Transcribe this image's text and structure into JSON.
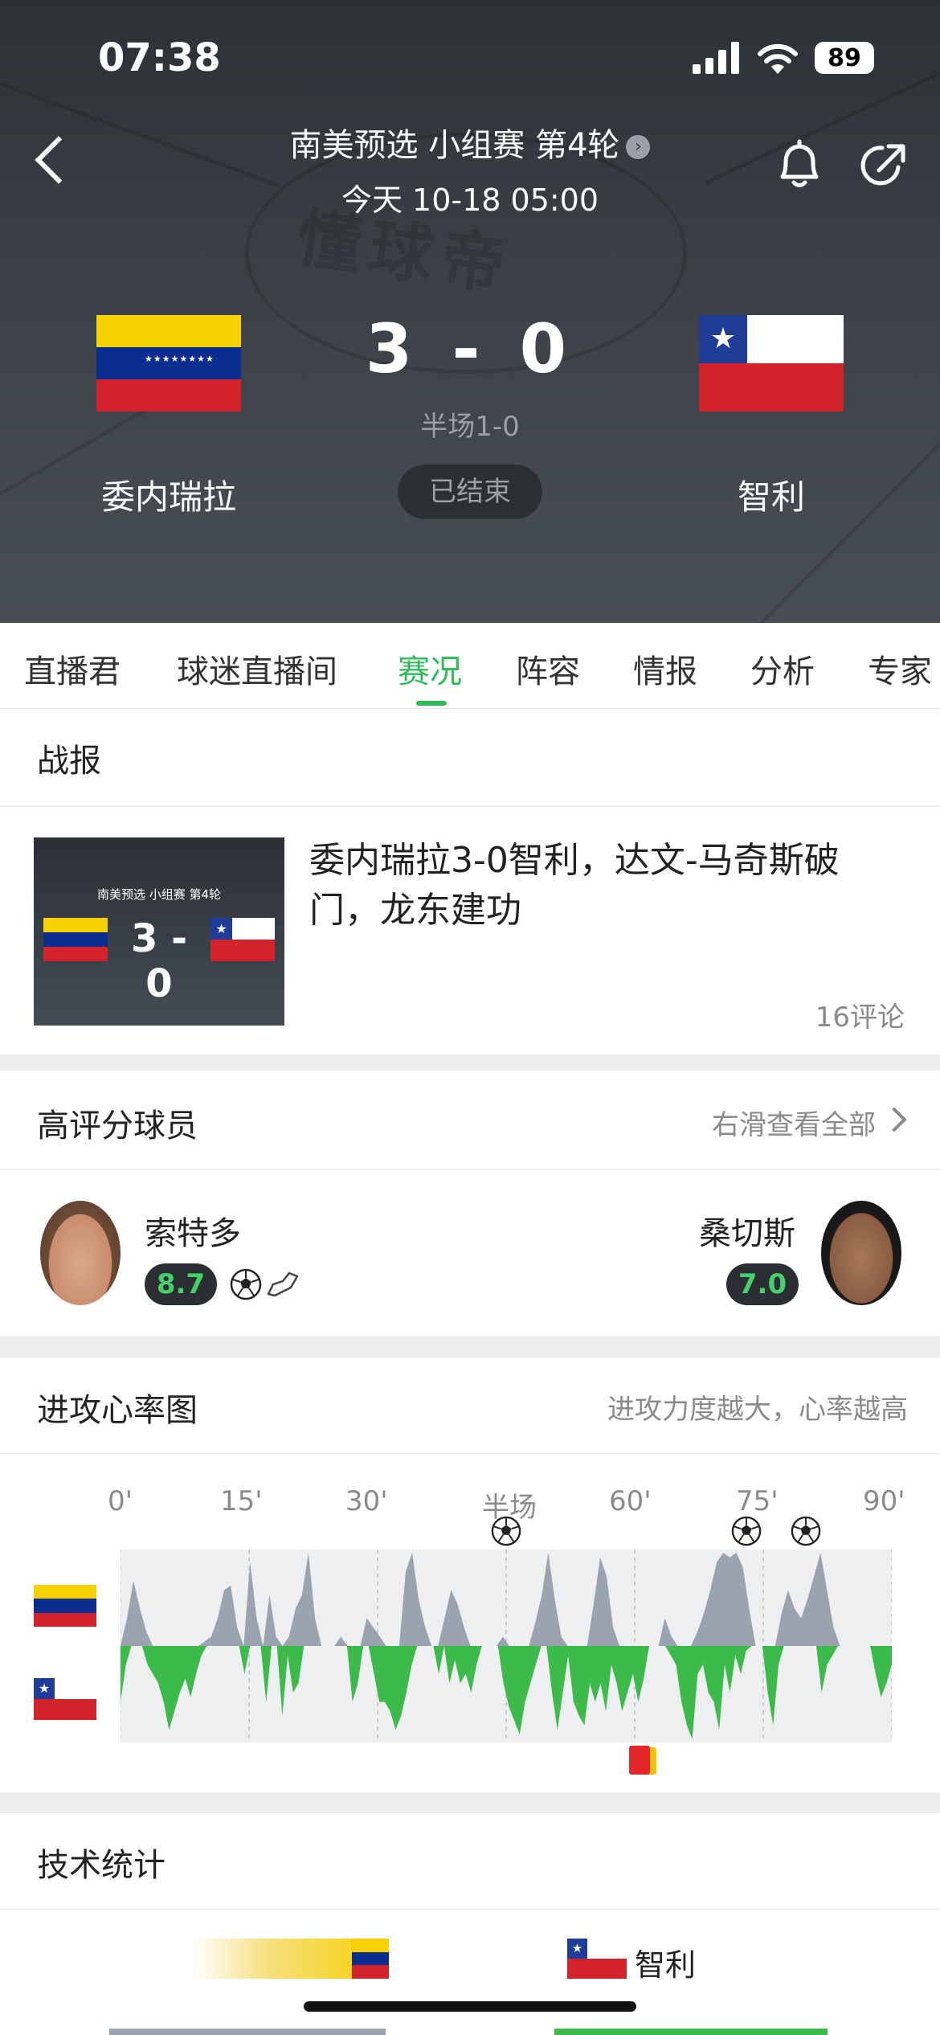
{
  "status_bar": {
    "time": "07:38",
    "battery": "89"
  },
  "match": {
    "league": "南美预选 小组赛 第4轮",
    "datetime": "今天 10-18 05:00",
    "home_team": "委内瑞拉",
    "away_team": "智利",
    "score": "3 - 0",
    "halftime": "半场1-0",
    "status": "已结束",
    "watermark": "懂球帝"
  },
  "tabs": [
    {
      "label": "直播君"
    },
    {
      "label": "球迷直播间"
    },
    {
      "label": "赛况",
      "active": true
    },
    {
      "label": "阵容"
    },
    {
      "label": "情报"
    },
    {
      "label": "分析"
    },
    {
      "label": "专家"
    }
  ],
  "report": {
    "title": "战报",
    "thumb_caption": "南美预选 小组赛 第4轮",
    "thumb_score": "3 - 0",
    "headline": "委内瑞拉3-0智利，达文-马奇斯破门，龙东建功",
    "comments": "16评论"
  },
  "top_players": {
    "title": "高评分球员",
    "more": "右滑查看全部",
    "home_player": {
      "name": "索特多",
      "rating": "8.7"
    },
    "away_player": {
      "name": "桑切斯",
      "rating": "7.0"
    }
  },
  "momentum": {
    "title": "进攻心率图",
    "subtitle": "进攻力度越大，心率越高",
    "ticks": [
      "0'",
      "15'",
      "30'",
      "半场",
      "60'",
      "75'",
      "90'"
    ],
    "home_color": "#9aa3ae",
    "away_color": "#3cba4a",
    "home_values": [
      0,
      0.3,
      0.7,
      0.4,
      0.15,
      0,
      0,
      0,
      0,
      0,
      0,
      0,
      0,
      0.05,
      0.1,
      0.3,
      0.6,
      0.65,
      0.2,
      0,
      0.9,
      0.3,
      0,
      0.55,
      0.1,
      0,
      0.1,
      0.4,
      0.55,
      1.0,
      0.3,
      0,
      0,
      0,
      0.1,
      0,
      0,
      0,
      0.3,
      0.2,
      0.1,
      0,
      0,
      0,
      0.8,
      1.0,
      0.5,
      0.2,
      0,
      0,
      0.3,
      0.6,
      0.45,
      0.2,
      0,
      0,
      0,
      0,
      0,
      0.1,
      0,
      0,
      0,
      0,
      0.25,
      0.55,
      1.0,
      0.5,
      0.1,
      0,
      0,
      0,
      0,
      0.45,
      0.95,
      0.75,
      0.2,
      0,
      0,
      0,
      0,
      0,
      0,
      0,
      0.3,
      0.1,
      0,
      0,
      0,
      0.15,
      0.35,
      0.6,
      0.9,
      1.0,
      0.95,
      1.0,
      0.85,
      0.4,
      0,
      0,
      0,
      0,
      0.35,
      0.6,
      0.4,
      0.3,
      0.5,
      0.75,
      1.0,
      0.6,
      0.2,
      0,
      0,
      0,
      0,
      0,
      0,
      0,
      0,
      0
    ],
    "away_values": [
      0.6,
      0.2,
      0,
      0,
      0,
      0.2,
      0.3,
      0.4,
      0.6,
      0.9,
      0.7,
      0.5,
      0.35,
      0.55,
      0.3,
      0.1,
      0,
      0,
      0,
      0,
      0,
      0,
      0,
      0.3,
      0,
      0,
      0,
      0.6,
      0,
      0,
      0.75,
      0.1,
      0.5,
      0.4,
      0,
      0,
      0,
      0,
      0,
      0,
      0,
      0,
      0,
      0.6,
      0.4,
      0,
      0,
      0.3,
      0.6,
      0.6,
      0.7,
      0.9,
      0.75,
      0.5,
      0.2,
      0,
      0,
      0,
      0,
      0.3,
      0,
      0.4,
      0.15,
      0.4,
      0.3,
      0.5,
      0.2,
      0,
      0,
      0,
      0,
      0.4,
      0.65,
      0.8,
      0.95,
      0.6,
      0.4,
      0.2,
      0,
      0,
      0.5,
      0.9,
      0.5,
      0.1,
      0.6,
      0.75,
      0.85,
      0.4,
      0.6,
      0.4,
      0.7,
      0.2,
      0.4,
      0.7,
      0.5,
      0.3,
      0.6,
      0.35,
      0,
      0,
      0,
      0,
      0.1,
      0.2,
      0.6,
      0.85,
      1.0,
      0.3,
      0.2,
      0.5,
      0.6,
      0.9,
      0.2,
      0.5,
      0.1,
      0.3,
      0.05,
      0,
      0,
      0,
      0.5,
      0.85,
      0.2,
      0,
      0,
      0,
      0,
      0,
      0,
      0,
      0.5,
      0.2,
      0.1,
      0,
      0,
      0,
      0,
      0,
      0,
      0,
      0.3,
      0.55,
      0.4,
      0.2
    ],
    "goal_minutes": [
      45,
      73,
      80
    ],
    "card_minute": 61
  },
  "stats": {
    "title": "技术统计",
    "away_team": "智利"
  }
}
